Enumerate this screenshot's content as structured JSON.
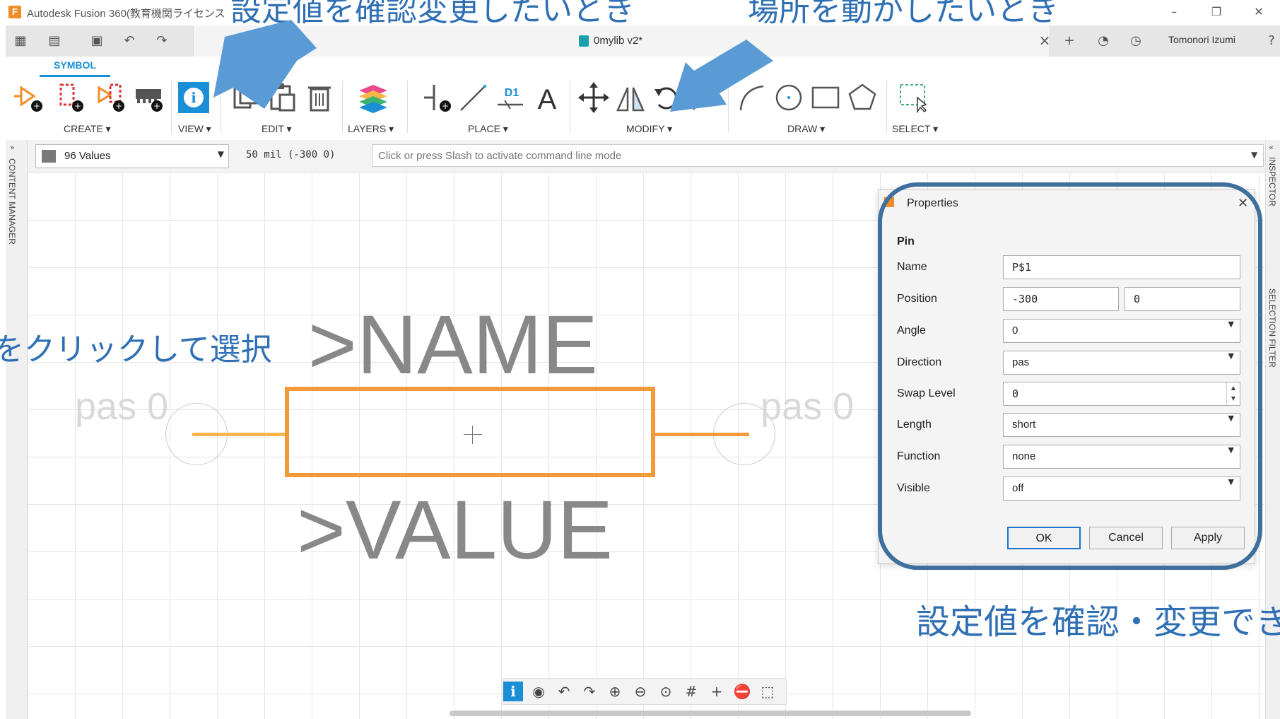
{
  "window": {
    "app_logo": "F",
    "title": "Autodesk Fusion 360(教育機関ライセンス",
    "doc_title": "0mylib v2*",
    "user": "Tomonori Izumi"
  },
  "ribbon": {
    "tab": "SYMBOL",
    "groups": [
      "CREATE ▾",
      "VIEW ▾",
      "EDIT ▾",
      "LAYERS ▾",
      "PLACE ▾",
      "MODIFY ▾",
      "DRAW ▾",
      "SELECT ▾"
    ]
  },
  "command_bar": {
    "layer": "96 Values",
    "grid": "50 mil (-300 0)",
    "placeholder": "Click or press Slash to activate command line mode"
  },
  "panels": {
    "left": "CONTENT MANAGER",
    "right_top": "INSPECTOR",
    "right_bottom": "SELECTION FILTER"
  },
  "symbol": {
    "name": ">NAME",
    "value": ">VALUE",
    "pin_left": "pas 0",
    "pin_right": "pas 0"
  },
  "properties": {
    "title": "Properties",
    "section": "Pin",
    "fields": {
      "name_label": "Name",
      "name_value": "P$1",
      "position_label": "Position",
      "position_x": "-300",
      "position_y": "0",
      "angle_label": "Angle",
      "angle_value": "0",
      "direction_label": "Direction",
      "direction_value": "pas",
      "swap_label": "Swap Level",
      "swap_value": "0",
      "length_label": "Length",
      "length_value": "short",
      "function_label": "Function",
      "function_value": "none",
      "visible_label": "Visible",
      "visible_value": "off"
    },
    "buttons": {
      "ok": "OK",
      "cancel": "Cancel",
      "apply": "Apply"
    }
  },
  "annotations": {
    "top_left": "設定値を確認変更したいとき",
    "top_right": "場所を動かしたいとき",
    "left": "をクリックして選択",
    "bottom_right": "設定値を確認・変更でき"
  },
  "colors": {
    "accent": "#1a8fd6",
    "symbol_outline": "#f29a3a",
    "pin": "#f6b64a",
    "annotation": "#2f6fb4",
    "arrow": "#5b9bd5"
  }
}
